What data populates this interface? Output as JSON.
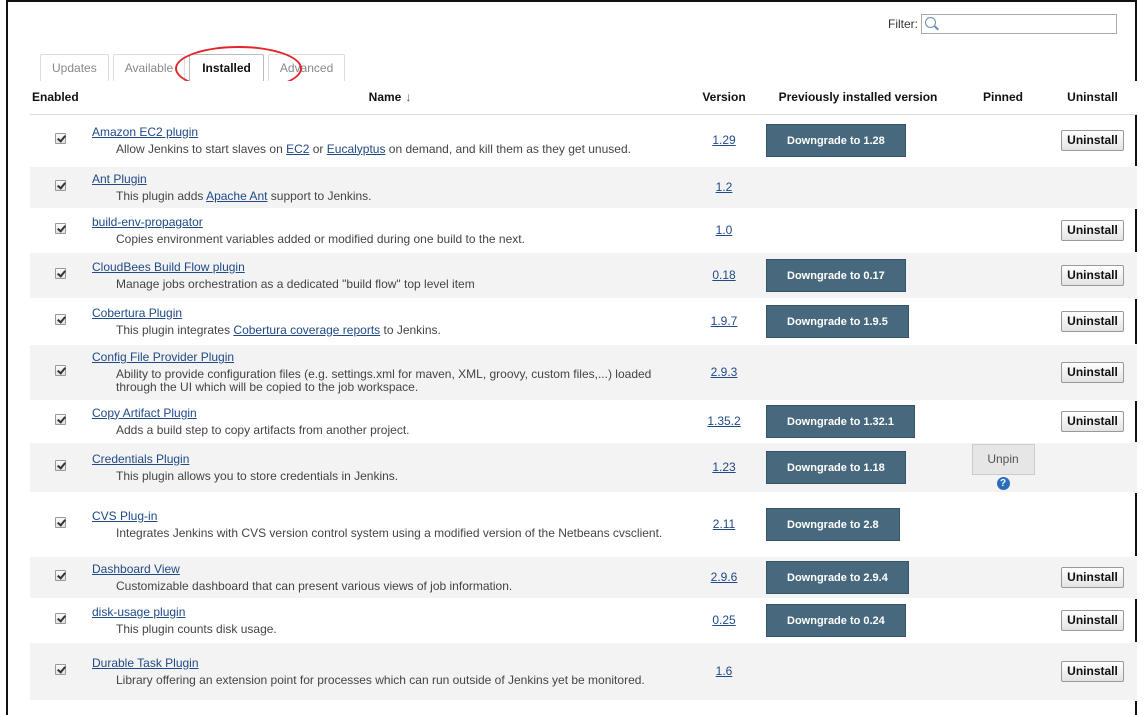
{
  "filter": {
    "label": "Filter:",
    "value": ""
  },
  "tabs": [
    "Updates",
    "Available",
    "Installed",
    "Advanced"
  ],
  "active_tab": "Installed",
  "columns": {
    "enabled": "Enabled",
    "name": "Name",
    "name_sort": "↓",
    "version": "Version",
    "previous": "Previously installed version",
    "pinned": "Pinned",
    "uninstall": "Uninstall"
  },
  "plugins": [
    {
      "name": "Amazon EC2 plugin",
      "desc": [
        {
          "t": "Allow Jenkins to start slaves on "
        },
        {
          "t": "EC2",
          "link": true
        },
        {
          "t": " or "
        },
        {
          "t": "Eucalyptus",
          "link": true
        },
        {
          "t": " on demand, and kill them as they get unused."
        }
      ],
      "version": "1.29",
      "downgrade": "Downgrade to 1.28",
      "uninstall": "Uninstall",
      "enabled": true
    },
    {
      "name": "Ant Plugin",
      "desc": [
        {
          "t": "This plugin adds "
        },
        {
          "t": "Apache Ant",
          "link": true
        },
        {
          "t": " support to Jenkins."
        }
      ],
      "version": "1.2",
      "enabled": true
    },
    {
      "name": "build-env-propagator",
      "desc": [
        {
          "t": "Copies environment variables added or modified during one build to the next."
        }
      ],
      "version": "1.0",
      "uninstall": "Uninstall",
      "enabled": true
    },
    {
      "name": "CloudBees Build Flow plugin",
      "desc": [
        {
          "t": "Manage jobs orchestration as a dedicated \"build flow\" top level item"
        }
      ],
      "version": "0.18",
      "downgrade": "Downgrade to 0.17",
      "uninstall": "Uninstall",
      "enabled": true
    },
    {
      "name": "Cobertura Plugin",
      "desc": [
        {
          "t": "This plugin integrates "
        },
        {
          "t": "Cobertura coverage reports",
          "link": true
        },
        {
          "t": " to Jenkins."
        }
      ],
      "version": "1.9.7",
      "downgrade": "Downgrade to 1.9.5",
      "uninstall": "Uninstall",
      "enabled": true
    },
    {
      "name": "Config File Provider Plugin",
      "desc": [
        {
          "t": "Ability to provide configuration files (e.g. settings.xml for maven, XML, groovy, custom files,...) loaded through the UI which will be copied to the job workspace."
        }
      ],
      "version": "2.9.3",
      "uninstall": "Uninstall",
      "enabled": true
    },
    {
      "name": "Copy Artifact Plugin",
      "desc": [
        {
          "t": "Adds a build step to copy artifacts from another project."
        }
      ],
      "version": "1.35.2",
      "downgrade": "Downgrade to 1.32.1",
      "uninstall": "Uninstall",
      "enabled": true
    },
    {
      "name": "Credentials Plugin",
      "desc": [
        {
          "t": "This plugin allows you to store credentials in Jenkins."
        }
      ],
      "version": "1.23",
      "downgrade": "Downgrade to 1.18",
      "pinned": "Unpin",
      "help": "?",
      "enabled": true
    },
    {
      "name": "CVS Plug-in",
      "desc": [
        {
          "t": "Integrates Jenkins with CVS version control system using a modified version of the Netbeans cvsclient."
        }
      ],
      "version": "2.11",
      "downgrade": "Downgrade to 2.8",
      "enabled": true
    },
    {
      "name": "Dashboard View",
      "desc": [
        {
          "t": "Customizable dashboard that can present various views of job information."
        }
      ],
      "version": "2.9.6",
      "downgrade": "Downgrade to 2.9.4",
      "uninstall": "Uninstall",
      "enabled": true
    },
    {
      "name": "disk-usage plugin",
      "desc": [
        {
          "t": "This plugin counts disk usage."
        }
      ],
      "version": "0.25",
      "downgrade": "Downgrade to 0.24",
      "uninstall": "Uninstall",
      "enabled": true
    },
    {
      "name": "Durable Task Plugin",
      "desc": [
        {
          "t": "Library offering an extension point for processes which can run outside of Jenkins yet be monitored."
        }
      ],
      "version": "1.6",
      "uninstall": "Uninstall",
      "enabled": true
    }
  ]
}
